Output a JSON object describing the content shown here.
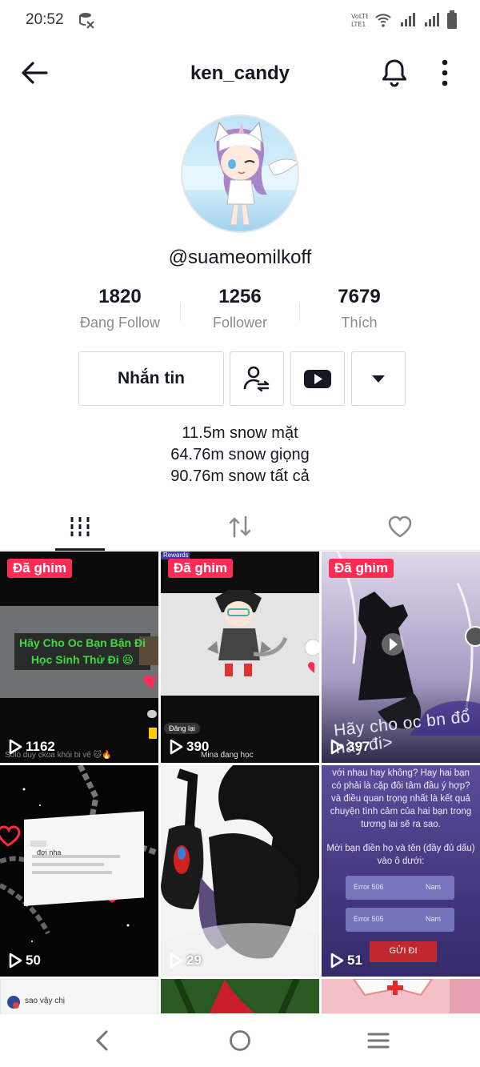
{
  "status_bar": {
    "time": "20:52"
  },
  "header": {
    "title": "ken_candy"
  },
  "profile": {
    "username": "@suameomilkoff"
  },
  "stats": [
    {
      "value": "1820",
      "label": "Đang Follow"
    },
    {
      "value": "1256",
      "label": "Follower"
    },
    {
      "value": "7679",
      "label": "Thích"
    }
  ],
  "actions": {
    "message_label": "Nhắn tin"
  },
  "bio": {
    "lines": [
      "11.5m snow mặt",
      "64.76m snow giọng",
      "90.76m snow tất cả"
    ]
  },
  "videos": [
    {
      "pinned": "Đã ghim",
      "views": "1162",
      "overlay_text": "Hãy Cho Oc Bạn Bận Đi Học Sinh Thử Đi 😆",
      "caption": "Solo duy ckoa khói bi vê 🐱🔥"
    },
    {
      "pinned": "Đã ghim",
      "views": "390",
      "corner_label": "Rewards",
      "replay": "Đăng lại",
      "caption": "Mina đang học"
    },
    {
      "pinned": "Đã ghim",
      "views": "397",
      "overlay_text": "Hãy cho oc bn đổ này đi>"
    },
    {
      "views": "50",
      "inner_name": "đợi nha"
    },
    {
      "views": "29"
    },
    {
      "views": "51",
      "overlay_text": "với nhau hay không? Hay hai bạn có phải là cặp đôi tâm đầu ý hợp? và điều quan trọng nhất là kết quả chuyện tình cảm của hai bạn trong tương lai sẽ ra sao.",
      "prompt": "Mời bạn điền họ và tên (đầy đủ dấu) vào ô dưới:",
      "field1": "Error 506",
      "field2": "Error 505",
      "select": "Nam",
      "submit": "GỬI ĐI"
    },
    {
      "comment": "sao vậy chị"
    },
    {},
    {}
  ]
}
